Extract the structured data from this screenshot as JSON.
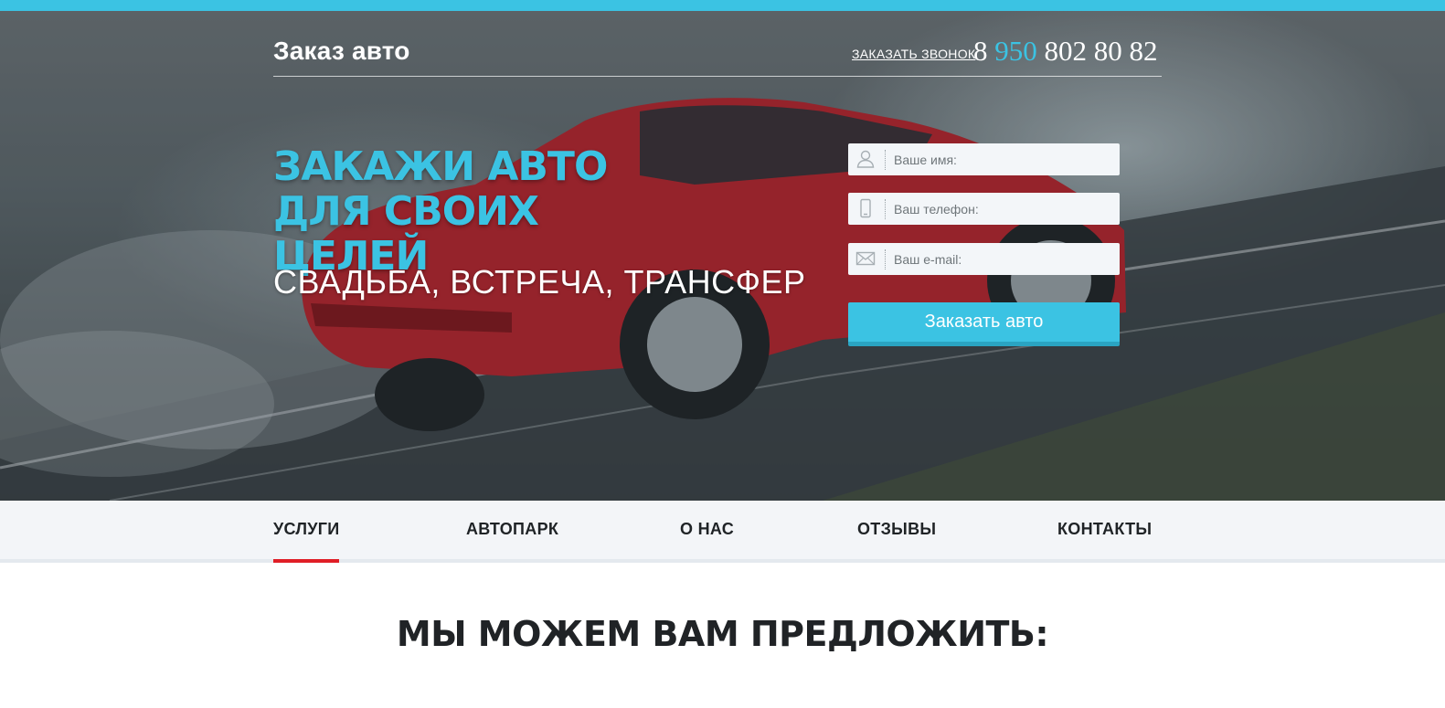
{
  "header": {
    "logo": "Заказ авто",
    "callback_link": "ЗАКАЗАТЬ ЗВОНОК",
    "phone_prefix": "8",
    "phone_code": "950",
    "phone_number": "802 80 82"
  },
  "hero": {
    "headline": "ЗАКАЖИ АВТО ДЛЯ СВОИХ ЦЕЛЕЙ",
    "subline": "СВАДЬБА, ВСТРЕЧА, ТРАНСФЕР"
  },
  "form": {
    "name_placeholder": "Ваше имя:",
    "name_icon": "user-icon",
    "phone_placeholder": "Ваш телефон:",
    "phone_icon": "mobile-phone-icon",
    "email_placeholder": "Ваш e-mail:",
    "email_icon": "envelope-icon",
    "submit_label": "Заказать авто"
  },
  "nav": {
    "items": [
      {
        "label": "УСЛУГИ",
        "active": true
      },
      {
        "label": "АВТОПАРК",
        "active": false
      },
      {
        "label": "О НАС",
        "active": false
      },
      {
        "label": "ОТЗЫВЫ",
        "active": false
      },
      {
        "label": "КОНТАКТЫ",
        "active": false
      }
    ]
  },
  "section": {
    "title": "МЫ МОЖЕМ ВАМ ПРЕДЛОЖИТЬ:"
  },
  "colors": {
    "accent": "#3bc3e3",
    "nav_active_underline": "#e01e26",
    "car": "#b8232c"
  }
}
